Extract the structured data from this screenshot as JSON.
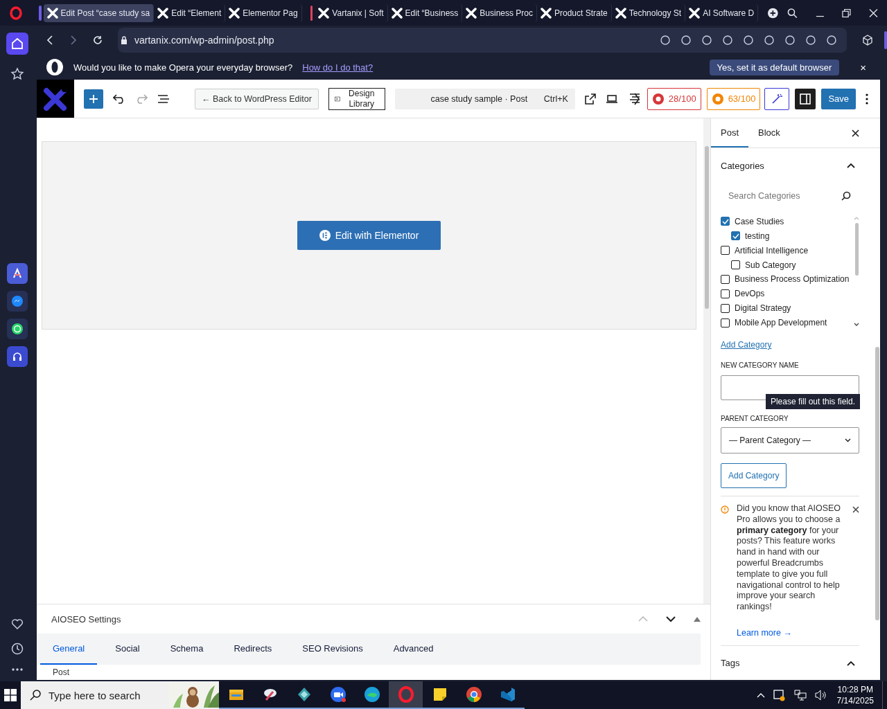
{
  "browser": {
    "tabs": [
      {
        "label": "Edit Post “case study sa",
        "selected": true,
        "color": "#6c5ce7"
      },
      {
        "label": "Edit “Element",
        "selected": false
      },
      {
        "label": "Elementor Pag",
        "selected": false
      },
      {
        "label": "Vartanix | Soft",
        "selected": false,
        "color": "#e0435a"
      },
      {
        "label": "Edit “Business",
        "selected": false
      },
      {
        "label": "Business Proc",
        "selected": false
      },
      {
        "label": "Product Strate",
        "selected": false
      },
      {
        "label": "Technology St",
        "selected": false
      },
      {
        "label": "AI Software D",
        "selected": false
      }
    ],
    "url": "vartanix.com/wp-admin/post.php",
    "banner": {
      "message": "Would you like to make Opera your everyday browser?",
      "link": "How do I do that?",
      "button": "Yes, set it as default browser",
      "close": "×"
    }
  },
  "editor_toolbar": {
    "back": "← Back to WordPress Editor",
    "design_library": "Design Library",
    "command": {
      "title": "case study sample · Post",
      "shortcut": "Ctrl+K"
    },
    "scores": [
      {
        "label": "28/100",
        "color": "#d63638"
      },
      {
        "label": "63/100",
        "color": "#f18500"
      }
    ],
    "save": "Save"
  },
  "elementor_button": "Edit with Elementor",
  "sidebar": {
    "tabs": [
      {
        "label": "Post",
        "selected": true
      },
      {
        "label": "Block",
        "selected": false
      }
    ],
    "categories": {
      "title": "Categories",
      "expanded": true,
      "search_placeholder": "Search Categories",
      "items": [
        {
          "label": "Case Studies",
          "checked": true,
          "children": [
            {
              "label": "testing",
              "checked": true
            }
          ]
        },
        {
          "label": "Artificial Intelligence",
          "checked": false,
          "children": [
            {
              "label": "Sub Category",
              "checked": false
            }
          ]
        },
        {
          "label": "Business Process Optimization",
          "checked": false
        },
        {
          "label": "DevOps",
          "checked": false
        },
        {
          "label": "Digital Strategy",
          "checked": false
        },
        {
          "label": "Mobile App Development",
          "checked": false
        }
      ],
      "add_link": "Add Category",
      "new_label": "NEW CATEGORY NAME",
      "tooltip": "Please fill out this field.",
      "parent_label": "PARENT CATEGORY",
      "parent_value": "— Parent Category —",
      "add_button": "Add Category"
    },
    "notice": {
      "text": "Did you know that AIOSEO Pro allows you to choose a **primary category** for your posts? This feature works hand in hand with our powerful Breadcrumbs template to give you full navigational control to help improve your search rankings!",
      "link": "Learn more →"
    },
    "tags": {
      "title": "Tags",
      "expanded": true
    }
  },
  "aioseo": {
    "title": "AIOSEO Settings",
    "tabs": [
      {
        "label": "General",
        "selected": true
      },
      {
        "label": "Social",
        "selected": false
      },
      {
        "label": "Schema",
        "selected": false
      },
      {
        "label": "Redirects",
        "selected": false
      },
      {
        "label": "SEO Revisions",
        "selected": false
      },
      {
        "label": "Advanced",
        "selected": false
      }
    ],
    "subtab": "Post"
  },
  "taskbar": {
    "search_placeholder": "Type here to search",
    "apps": [
      {
        "kind": "folder",
        "selected": false
      },
      {
        "kind": "brush",
        "selected": false
      },
      {
        "kind": "diamond",
        "selected": false
      },
      {
        "kind": "video",
        "selected": false
      },
      {
        "kind": "edge",
        "selected": false
      },
      {
        "kind": "opera",
        "selected": true
      },
      {
        "kind": "note",
        "selected": false
      },
      {
        "kind": "chrome",
        "selected": false
      },
      {
        "kind": "code",
        "selected": false
      }
    ],
    "time": "10:28 PM",
    "date": "7/14/2025"
  }
}
